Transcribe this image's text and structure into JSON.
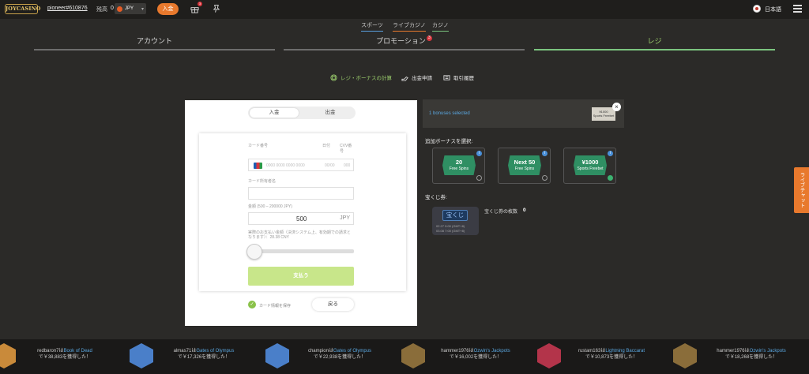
{
  "header": {
    "logo": "JOYCASINO",
    "username": "pioneer#610876",
    "balance_label": "残高",
    "balance": "0",
    "currency": "JPY",
    "deposit_label": "入金",
    "gift_badge": "3",
    "language": "日本語"
  },
  "subnav": [
    "スポーツ",
    "ライブカジノ",
    "カジノ"
  ],
  "tabs": {
    "account": "アカウント",
    "promotion": "プロモーション",
    "promotion_badge": "3",
    "cashier": "レジ"
  },
  "subtabs": {
    "bonus": "レジ・ボーナスの計算",
    "withdraw": "出金申請",
    "history": "取引履歴"
  },
  "payment": {
    "deposit_tab": "入金",
    "withdraw_tab": "出金",
    "card_number_label": "カード番号",
    "expiry_label": "日付",
    "cvv_label": "CVV番号",
    "card_number_placeholder": "0000 0000 0000 0000",
    "expiry_placeholder": "00/00",
    "cvv_placeholder": "000",
    "holder_label": "カード所有者名",
    "amount_label": "金額 (500 – 200000 JPY)",
    "amount": "500",
    "amount_currency": "JPY",
    "note": "実際のお支払い金額（決済システム上、有効期での請求となります）：28.38 CNY",
    "pay_label": "支払う",
    "save_card_label": "カード情報を保存",
    "back_label": "戻る"
  },
  "selected": {
    "text": "1 bonuses selected",
    "mini_value": "¥1000",
    "mini_label": "Sports Freebet"
  },
  "bonus_section": {
    "title": "追加ボーナスを選択:",
    "items": [
      {
        "value": "20",
        "label": "Free Spins",
        "selected": false
      },
      {
        "value": "Next 50",
        "label": "Free Spins",
        "selected": false
      },
      {
        "value": "¥1000",
        "label": "Sports Freebet",
        "selected": true
      }
    ]
  },
  "lottery": {
    "title": "宝くじ券:",
    "badge": "宝くじ",
    "date1": "02.27 9:00 (GMT+8)",
    "date2": "03.08 7:00 (GMT+8)",
    "count_label": "宝くじ券の枚数",
    "count": "0"
  },
  "live_chat": "ライブチャット",
  "ticker": [
    {
      "user": "redbaron7は",
      "game": "Book of Dead",
      "amount": "で￥38,883を獲得した！",
      "color": "#c98a3a"
    },
    {
      "user": "almas71は",
      "game": "Gates of Olympus",
      "amount": "で￥17,326を獲得した！",
      "color": "#4a7fc9"
    },
    {
      "user": "championは",
      "game": "Gates of Olympus",
      "amount": "で￥22,938を獲得した！",
      "color": "#4a7fc9"
    },
    {
      "user": "hammer1976は",
      "game": "Ozwin's Jackpots",
      "amount": "で￥16,002を獲得した！",
      "color": "#8a6d3a"
    },
    {
      "user": "rustam163は",
      "game": "Lightning Baccarat",
      "amount": "で￥10,873を獲得した！",
      "color": "#b3344a"
    },
    {
      "user": "hammer1976は",
      "game": "Ozwin's Jackpots",
      "amount": "で￥18,268を獲得した！",
      "color": "#8a6d3a"
    }
  ]
}
